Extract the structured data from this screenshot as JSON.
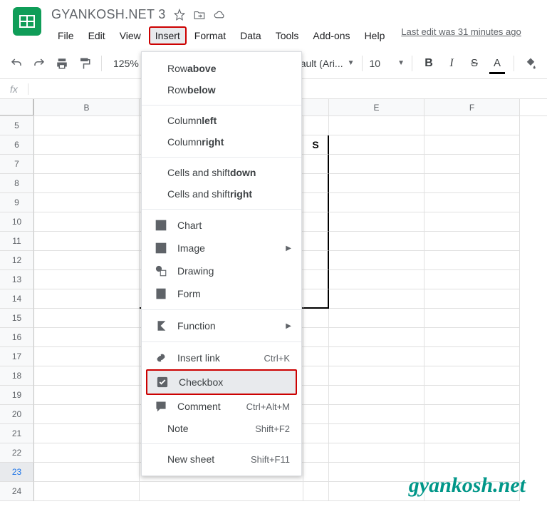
{
  "doc": {
    "title": "GYANKOSH.NET 3"
  },
  "menubar": {
    "file": "File",
    "edit": "Edit",
    "view": "View",
    "insert": "Insert",
    "format": "Format",
    "data": "Data",
    "tools": "Tools",
    "addons": "Add-ons",
    "help": "Help",
    "last_edit": "Last edit was 31 minutes ago"
  },
  "toolbar": {
    "zoom": "125%",
    "font": "efault (Ari...",
    "size": "10"
  },
  "columns": [
    "B",
    "E",
    "F"
  ],
  "rows": [
    5,
    6,
    7,
    8,
    9,
    10,
    11,
    12,
    13,
    14,
    15,
    16,
    17,
    18,
    19,
    20,
    21,
    22,
    23,
    24
  ],
  "partial_cell": "S",
  "insert_menu": {
    "row_above_1": "Row ",
    "row_above_2": "above",
    "row_below_1": "Row ",
    "row_below_2": "below",
    "col_left_1": "Column ",
    "col_left_2": "left",
    "col_right_1": "Column ",
    "col_right_2": "right",
    "cells_down_1": "Cells and shift ",
    "cells_down_2": "down",
    "cells_right_1": "Cells and shift ",
    "cells_right_2": "right",
    "chart": "Chart",
    "image": "Image",
    "drawing": "Drawing",
    "form": "Form",
    "function": "Function",
    "link": "Insert link",
    "link_sc": "Ctrl+K",
    "checkbox": "Checkbox",
    "comment": "Comment",
    "comment_sc": "Ctrl+Alt+M",
    "note": "Note",
    "note_sc": "Shift+F2",
    "newsheet": "New sheet",
    "newsheet_sc": "Shift+F11"
  },
  "watermark": "gyankosh.net"
}
